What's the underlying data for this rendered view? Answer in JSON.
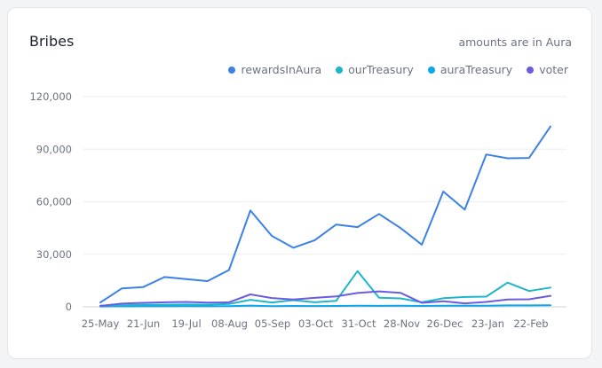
{
  "card": {
    "title": "Bribes",
    "note": "amounts are in Aura"
  },
  "chart_data": {
    "type": "line",
    "title": "Bribes",
    "xlabel": "",
    "ylabel": "",
    "ylim": [
      0,
      120000
    ],
    "y_ticks": [
      "0",
      "30,000",
      "60,000",
      "90,000",
      "120,000"
    ],
    "y_tick_values": [
      0,
      30000,
      60000,
      90000,
      120000
    ],
    "x_tick_labels": [
      "25-May",
      "21-Jun",
      "19-Jul",
      "08-Aug",
      "05-Sep",
      "03-Oct",
      "31-Oct",
      "28-Nov",
      "26-Dec",
      "23-Jan",
      "22-Feb"
    ],
    "grid": "horizontal",
    "legend_position": "top-right",
    "series": [
      {
        "name": "rewardsInAura",
        "color": "#3b82e6",
        "values": [
          2500,
          10500,
          11300,
          17000,
          15800,
          14700,
          21000,
          55000,
          40500,
          33700,
          38000,
          47000,
          45500,
          53000,
          45000,
          35500,
          65800,
          55500,
          87000,
          84800,
          85000,
          103000
        ]
      },
      {
        "name": "ourTreasury",
        "color": "#1fb5c9",
        "values": [
          600,
          900,
          1100,
          1200,
          1300,
          1200,
          1600,
          4000,
          2500,
          3800,
          2600,
          3400,
          20400,
          5200,
          4800,
          2600,
          4900,
          5600,
          5800,
          13800,
          9000,
          11000
        ]
      },
      {
        "name": "auraTreasury",
        "color": "#0ea5e9",
        "values": [
          200,
          250,
          300,
          300,
          350,
          300,
          400,
          700,
          400,
          500,
          450,
          500,
          600,
          550,
          600,
          500,
          600,
          600,
          650,
          800,
          800,
          900
        ]
      },
      {
        "name": "voter",
        "color": "#6a5ce0",
        "values": [
          500,
          1800,
          2300,
          2600,
          2800,
          2400,
          2600,
          7100,
          5000,
          4200,
          5100,
          5900,
          7900,
          8800,
          8000,
          2300,
          3200,
          2000,
          2800,
          4200,
          4300,
          6300
        ]
      }
    ]
  }
}
